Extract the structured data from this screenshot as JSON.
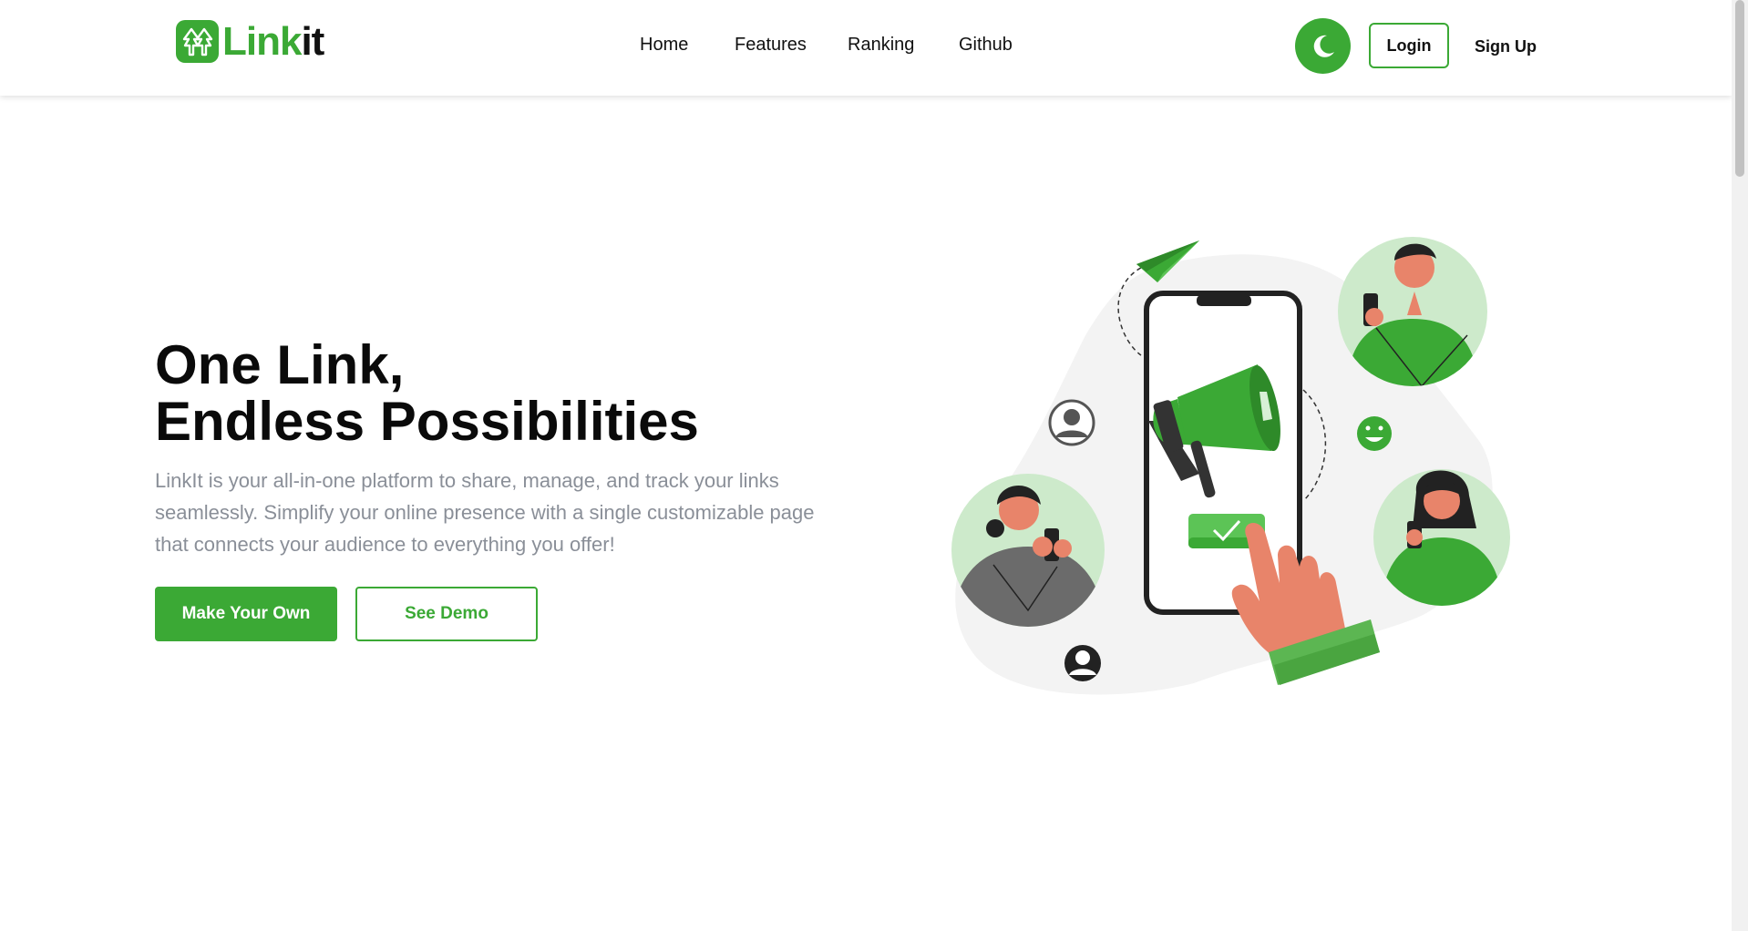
{
  "brand": {
    "name_part1": "Link",
    "name_part2": "it",
    "primary_color": "#3ba935",
    "logo_icon": "double-up-arrow-icon"
  },
  "nav": {
    "items": [
      {
        "label": "Home"
      },
      {
        "label": "Features"
      },
      {
        "label": "Ranking"
      },
      {
        "label": "Github"
      }
    ]
  },
  "header_actions": {
    "theme_toggle_icon": "moon-icon",
    "login_label": "Login",
    "signup_label": "Sign Up"
  },
  "hero": {
    "title_line1": "One Link,",
    "title_line2": "Endless Possibilities",
    "description": "LinkIt is your all-in-one platform to share, manage, and track your links seamlessly. Simplify your online presence with a single customizable page that connects your audience to everything you offer!",
    "primary_cta": "Make Your Own",
    "secondary_cta": "See Demo",
    "illustration_icons": [
      "phone-icon",
      "megaphone-icon",
      "paper-plane-icon",
      "pointing-hand-icon",
      "checkmark-icon",
      "user-avatar-icon",
      "smiley-icon"
    ]
  }
}
